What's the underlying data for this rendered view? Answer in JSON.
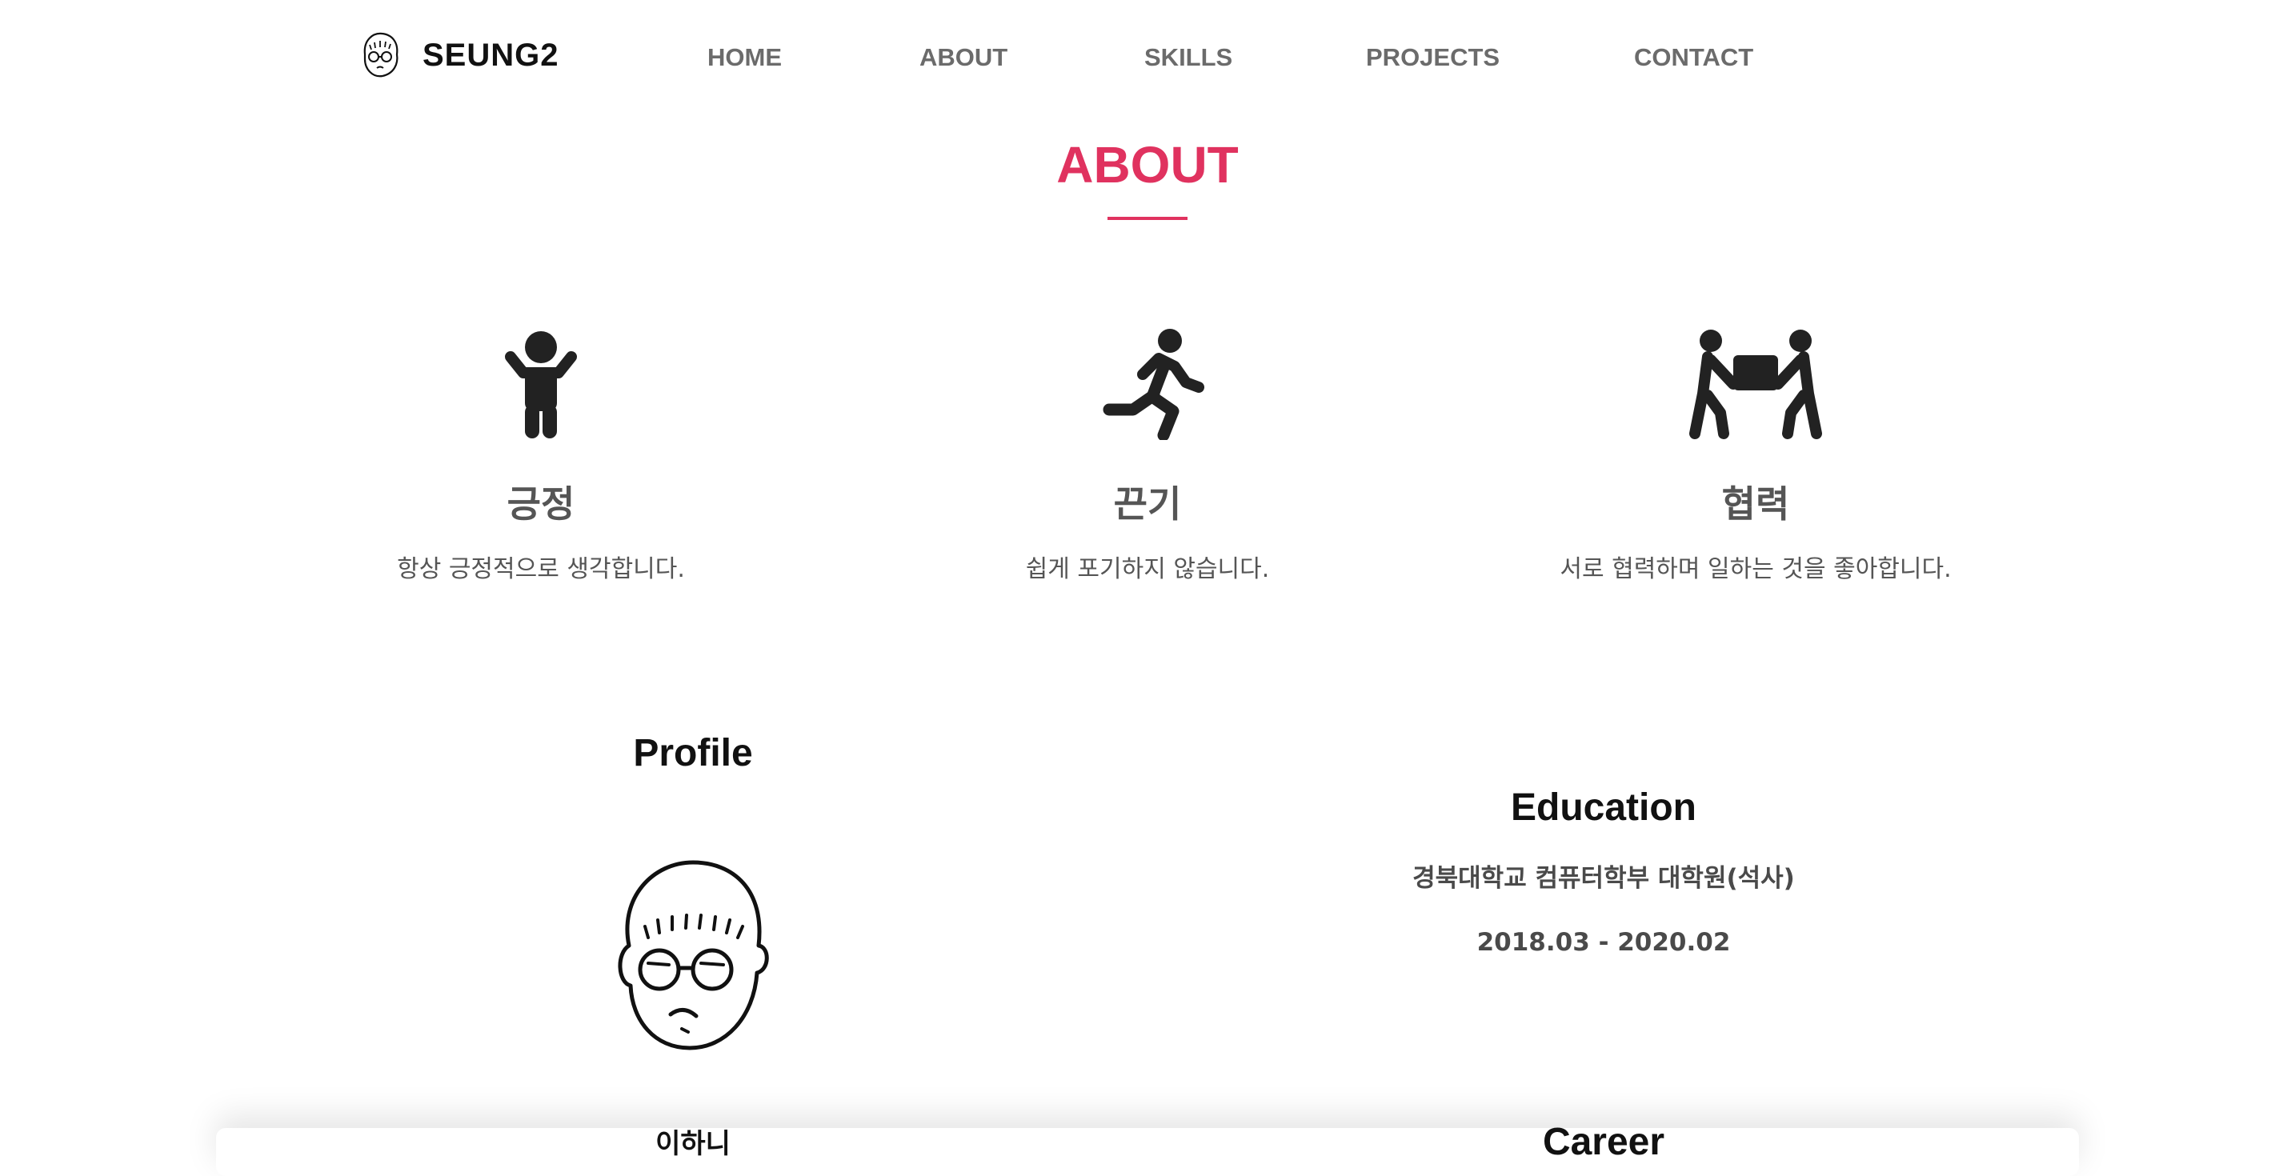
{
  "nav": {
    "brand": "SEUNG2",
    "logo_icon": "face-with-glasses-icon",
    "items": [
      {
        "label": "HOME"
      },
      {
        "label": "ABOUT"
      },
      {
        "label": "SKILLS"
      },
      {
        "label": "PROJECTS"
      },
      {
        "label": "CONTACT"
      }
    ]
  },
  "about": {
    "title": "ABOUT",
    "accent_color": "#e0325f",
    "values": [
      {
        "icon": "child-arms-up-icon",
        "title": "긍정",
        "desc": "항상 긍정적으로 생각합니다."
      },
      {
        "icon": "person-running-icon",
        "title": "끈기",
        "desc": "쉽게 포기하지 않습니다."
      },
      {
        "icon": "people-carry-box-icon",
        "title": "협력",
        "desc": "서로 협력하며 일하는 것을 좋아합니다."
      }
    ]
  },
  "profile": {
    "title": "Profile",
    "avatar_icon": "face-with-glasses-icon",
    "name_partial": "이하니"
  },
  "education": {
    "title": "Education",
    "school": "경북대학교 컴퓨터학부 대학원(석사)",
    "period": "2018.03 - 2020.02"
  },
  "career": {
    "title": "Career"
  }
}
